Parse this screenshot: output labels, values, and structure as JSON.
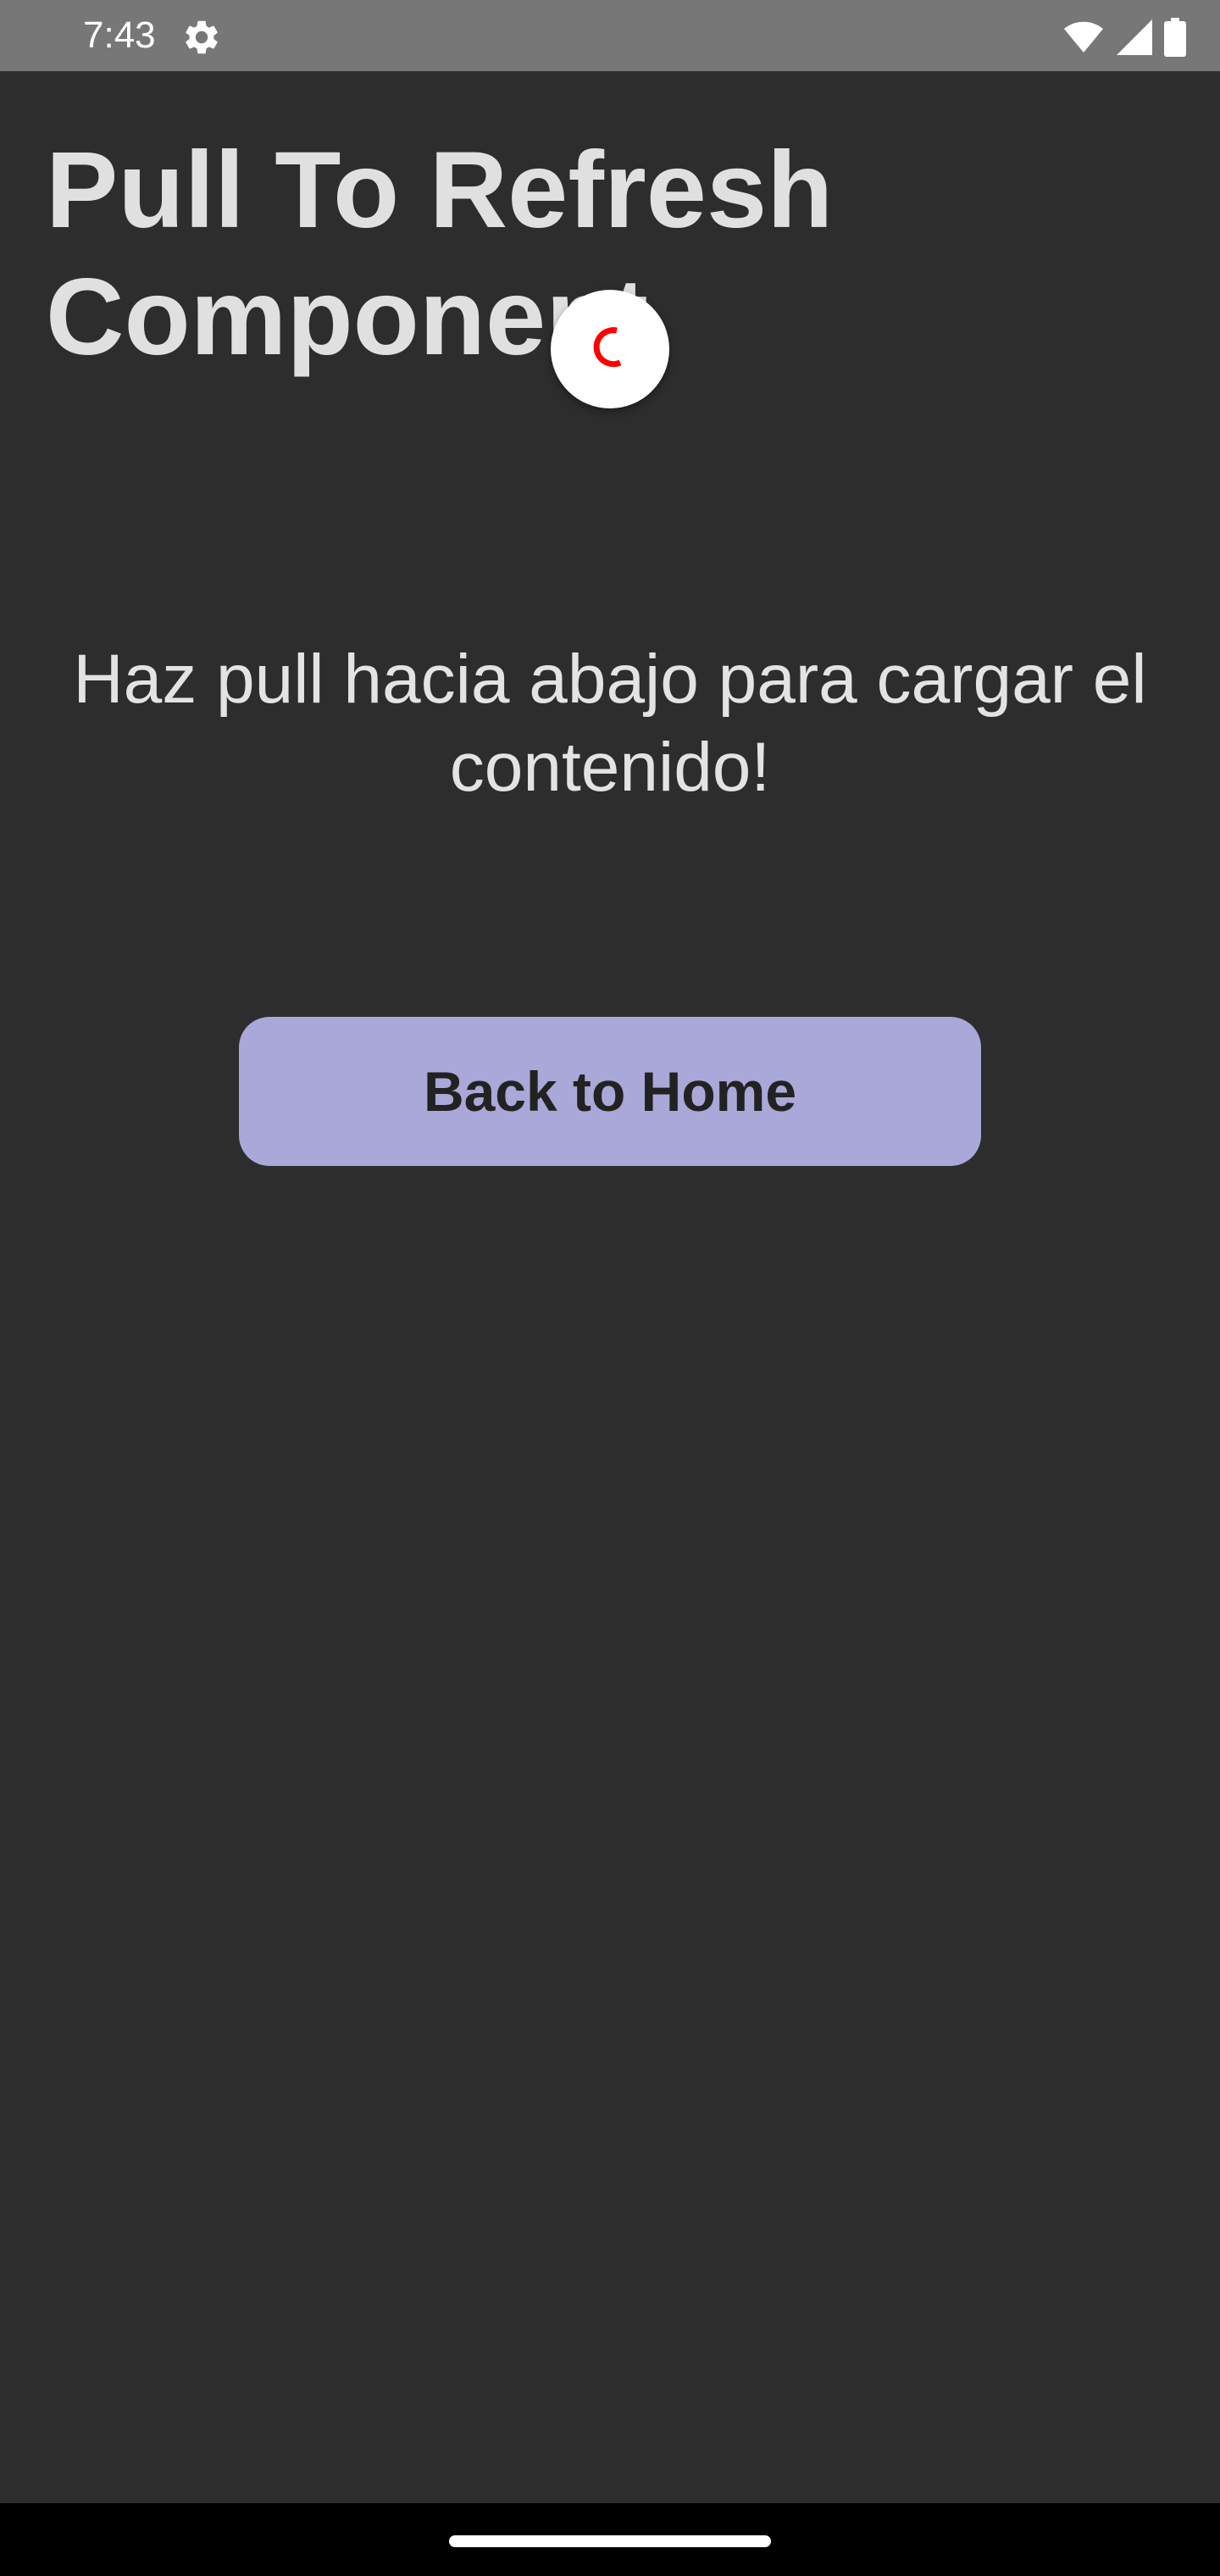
{
  "status_bar": {
    "time": "7:43",
    "icons": [
      "settings-gear-icon",
      "wifi-icon",
      "signal-icon",
      "battery-icon"
    ]
  },
  "page": {
    "title": "Pull To Refresh Component",
    "instruction": "Haz pull hacia abajo para cargar el contenido!",
    "button_label": "Back to Home"
  },
  "refresh_indicator": {
    "icon": "loading-spinner-icon",
    "spinner_color": "#ff0000"
  },
  "colors": {
    "background": "#2d2d2e",
    "status_bar": "#777777",
    "button": "#a9a8d8",
    "title_text": "#e0e0e0"
  }
}
